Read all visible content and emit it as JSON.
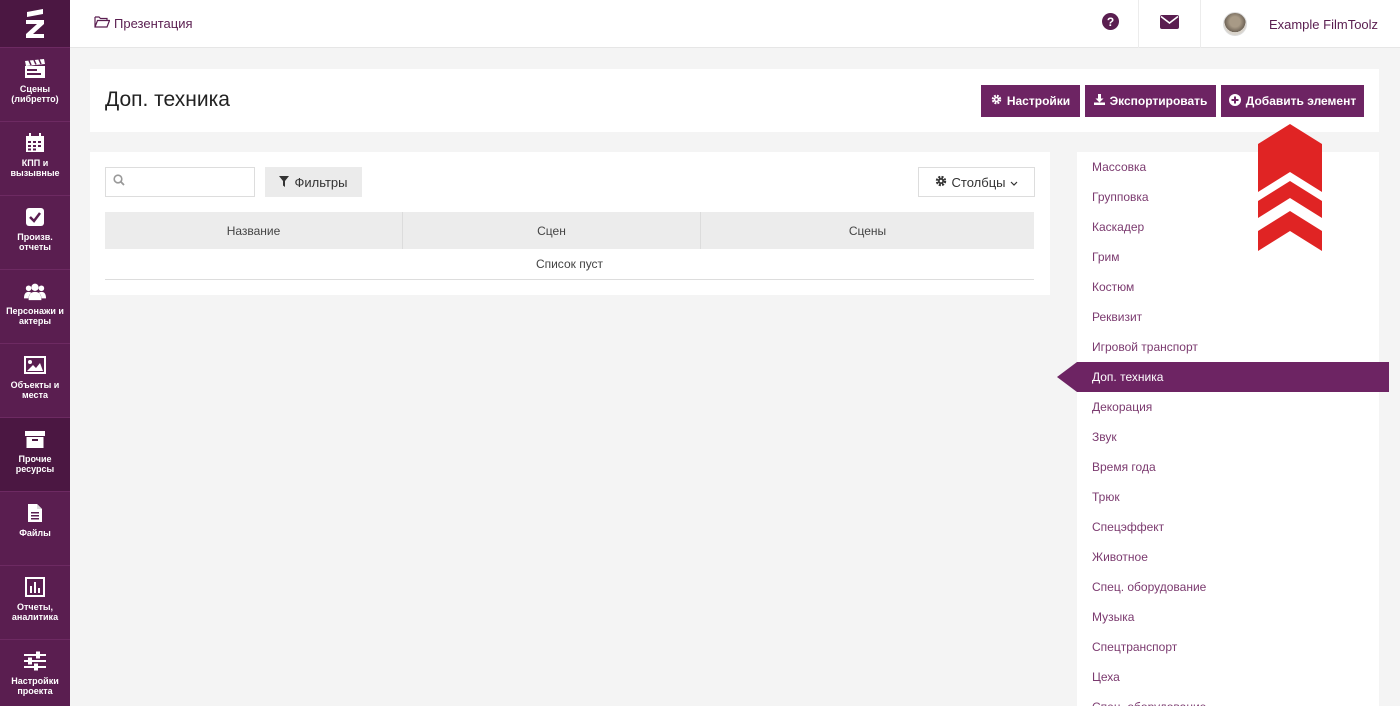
{
  "sidebar": {
    "logo_icon": "film-toolz-logo",
    "items": [
      {
        "label": "Сцены (либретто)",
        "icon": "clapperboard-icon"
      },
      {
        "label": "КПП и вызывные",
        "icon": "calendar-icon"
      },
      {
        "label": "Произв. отчеты",
        "icon": "checkbox-icon"
      },
      {
        "label": "Персонажи и актеры",
        "icon": "people-icon"
      },
      {
        "label": "Объекты и места",
        "icon": "image-icon"
      },
      {
        "label": "Прочие ресурсы",
        "icon": "archive-icon"
      },
      {
        "label": "Файлы",
        "icon": "file-icon"
      },
      {
        "label": "Отчеты, аналитика",
        "icon": "bar-chart-icon"
      },
      {
        "label": "Настройки проекта",
        "icon": "sliders-icon"
      }
    ]
  },
  "topbar": {
    "breadcrumb": "Презентация",
    "user_name": "Example FilmToolz"
  },
  "header": {
    "title": "Доп. техника",
    "settings_label": "Настройки",
    "export_label": "Экспортировать",
    "add_label": "Добавить элемент"
  },
  "table": {
    "search_placeholder": "",
    "filters_label": "Фильтры",
    "columns_label": "Столбцы",
    "headers": [
      "Название",
      "Сцен",
      "Сцены"
    ],
    "empty_text": "Список пуст"
  },
  "categories": {
    "active": "Доп. техника",
    "items": [
      "Массовка",
      "Групповка",
      "Каскадер",
      "Грим",
      "Костюм",
      "Реквизит",
      "Игровой транспорт",
      "Доп. техника",
      "Декорация",
      "Звук",
      "Время года",
      "Трюк",
      "Спецэффект",
      "Животное",
      "Спец. оборудование",
      "Музыка",
      "Спецтранспорт",
      "Цеха",
      "Спец. оборудование"
    ]
  },
  "colors": {
    "brand": "#6d2463",
    "sidebar": "#5a1e50",
    "arrow": "#e02424"
  }
}
